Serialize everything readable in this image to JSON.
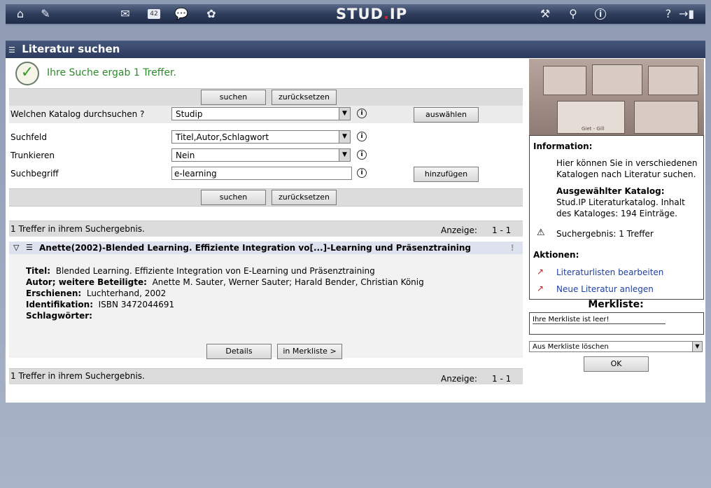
{
  "topbar": {
    "logo_prefix": "STUD",
    "logo_dot": ".",
    "logo_suffix": "IP",
    "icons": [
      "home-icon",
      "tools-icon",
      "mail-icon",
      "calendar-icon",
      "chat-icon",
      "guestbook-icon",
      "admin-icon",
      "search-icon",
      "info-icon",
      "help-icon",
      "logout-icon"
    ],
    "calendar_day": "42",
    "help_glyph": "?"
  },
  "panel": {
    "title": "Literatur suchen"
  },
  "success": {
    "message": "Ihre Suche ergab 1 Treffer."
  },
  "buttons": {
    "search": "suchen",
    "reset": "zurücksetzen",
    "select": "auswählen",
    "add": "hinzufügen",
    "details": "Details",
    "merkliste": "in Merkliste  >",
    "ok": "OK"
  },
  "form": {
    "catalog_label": "Welchen Katalog durchsuchen ?",
    "catalog_value": "Studip",
    "field_label": "Suchfeld",
    "field_value": "Titel,Autor,Schlagwort",
    "trunc_label": "Trunkieren",
    "trunc_value": "Nein",
    "term_label": "Suchbegriff",
    "term_value": "e-learning",
    "info_glyph": "i"
  },
  "results": {
    "count_text": "1 Treffer in ihrem Suchergebnis.",
    "display_label": "Anzeige:",
    "display_range": "1 - 1",
    "item": {
      "header": "Anette(2002)-Blended Learning. Effiziente Integration vo[...]-Learning und Präsenztraining",
      "title_label": "Titel:",
      "title_value": "Blended Learning. Effiziente Integration von E-Learning und Präsenztraining",
      "author_label": "Autor; weitere Beteiligte:",
      "author_value": "Anette M. Sauter, Werner Sauter; Harald Bender, Christian König",
      "published_label": "Erschienen:",
      "published_value": "Luchterhand, 2002",
      "id_label": "Identifikation:",
      "id_value": "ISBN 3472044691",
      "keywords_label": "Schlagwörter:",
      "flag": "!"
    }
  },
  "sidebar": {
    "image_caption": "Giet - Gill",
    "info_heading": "Information:",
    "info_text": "Hier können Sie in verschiedenen Katalogen nach Literatur suchen.",
    "selected_heading": "Ausgewählter Katalog:",
    "selected_text": "Stud.IP Literaturkatalog. Inhalt des Kataloges: 194 Einträge.",
    "result_text": "Suchergebnis: 1 Treffer",
    "actions_heading": "Aktionen:",
    "action_1": "Literaturlisten bearbeiten",
    "action_2": "Neue Literatur anlegen",
    "merkliste_title": "Merkliste:",
    "merkliste_empty": "Ihre Merkliste ist leer!",
    "merkliste_select": "Aus Merkliste löschen"
  }
}
